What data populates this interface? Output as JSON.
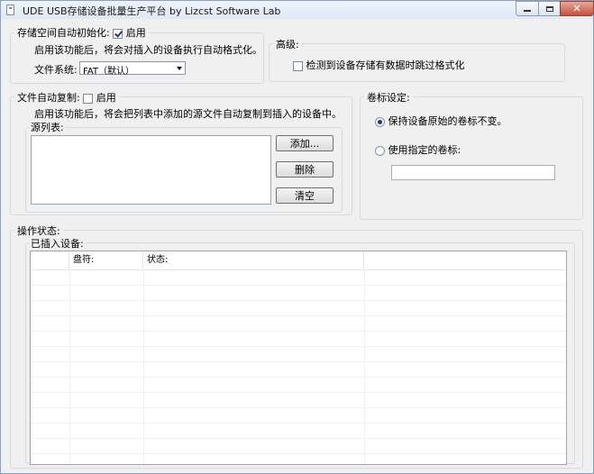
{
  "window": {
    "title": "UDE USB存储设备批量生产平台      by Lizcst Software Lab"
  },
  "auto_format": {
    "label": "存储空间自动初始化:",
    "enable_label": "启用",
    "enabled": true,
    "description": "启用该功能后，将会对插入的设备执行自动格式化。",
    "fs_label": "文件系统:",
    "fs_value": "FAT（默认）"
  },
  "advanced": {
    "label": "高级:",
    "skip_label": "检测到设备存储有数据时跳过格式化",
    "skip_checked": false
  },
  "auto_copy": {
    "label": "文件自动复制:",
    "enable_label": "启用",
    "enabled": false,
    "description": "启用该功能后，将会把列表中添加的源文件自动复制到插入的设备中。",
    "source_label": "源列表:",
    "buttons": {
      "add": "添加...",
      "delete": "删除",
      "clear": "清空"
    }
  },
  "volume_label": {
    "label": "卷标设定:",
    "keep_label": "保持设备原始的卷标不变。",
    "use_label": "使用指定的卷标:",
    "selected": "keep",
    "value": ""
  },
  "status": {
    "label": "操作状态:",
    "devices_label": "已插入设备:",
    "columns": [
      "",
      "盘符:",
      "状态:",
      ""
    ]
  }
}
